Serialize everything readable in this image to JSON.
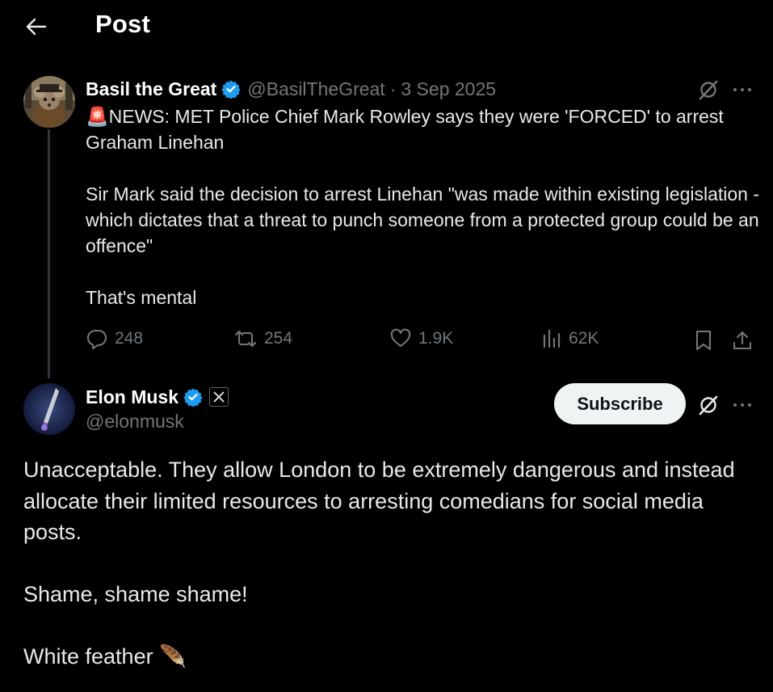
{
  "header": {
    "title": "Post"
  },
  "quoted_post": {
    "author_name": "Basil the Great",
    "handle": "@BasilTheGreat",
    "separator": "·",
    "date": "3 Sep 2025",
    "text": "🚨NEWS: MET Police Chief Mark Rowley says they were 'FORCED' to arrest Graham Linehan\n\nSir Mark said the decision to arrest Linehan \"was made within existing legislation - which dictates that a threat to punch someone from a protected group could be an offence\"\n\nThat's mental",
    "stats": {
      "replies": "248",
      "reposts": "254",
      "likes": "1.9K",
      "views": "62K"
    }
  },
  "main_post": {
    "author_name": "Elon Musk",
    "handle": "@elonmusk",
    "subscribe_label": "Subscribe",
    "text": "Unacceptable. They allow London to be extremely dangerous and instead allocate their limited resources to arresting comedians for social media posts.\n\nShame, shame shame!\n\nWhite feather 🪶"
  },
  "colors": {
    "background": "#000000",
    "verified": "#1d9bf0",
    "muted": "#71767b",
    "text": "#e7e9ea"
  },
  "icons": [
    "back-arrow-icon",
    "verified-badge-icon",
    "grok-icon",
    "more-icon",
    "reply-icon",
    "repost-icon",
    "like-icon",
    "views-icon",
    "bookmark-icon",
    "share-icon",
    "x-affiliate-icon"
  ]
}
